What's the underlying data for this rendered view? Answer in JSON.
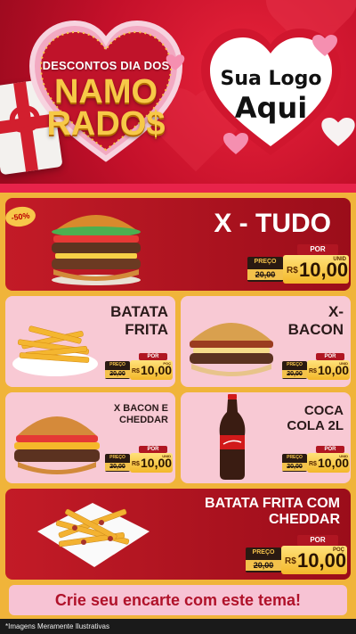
{
  "banner": {
    "line1": "DESCONTOS DIA DOS",
    "line2": "NAMO",
    "line3": "RADO$",
    "logo_line1": "Sua Logo",
    "logo_line2": "Aqui"
  },
  "colors": {
    "red": "#c31b27",
    "gold": "#f7c948",
    "pink": "#f8c9d4",
    "orange": "#f0b43a"
  },
  "discount_badge": "-50%",
  "products": [
    {
      "name": "X - TUDO",
      "por": "POR",
      "preco_label": "PREÇO",
      "old_price": "20,00",
      "currency": "R$",
      "price": "10,00",
      "unit": "UNID",
      "image": "burger-x-tudo"
    },
    {
      "name": "BATATA FRITA",
      "por": "POR",
      "preco_label": "PREÇO",
      "old_price": "20,00",
      "currency": "R$",
      "price": "10,00",
      "unit": "POÇ",
      "image": "french-fries"
    },
    {
      "name": "X-BACON",
      "por": "POR",
      "preco_label": "PREÇO",
      "old_price": "20,00",
      "currency": "R$",
      "price": "10,00",
      "unit": "UNID",
      "image": "burger-x-bacon"
    },
    {
      "name": "X BACON E CHEDDAR",
      "por": "POR",
      "preco_label": "PREÇO",
      "old_price": "20,00",
      "currency": "R$",
      "price": "10,00",
      "unit": "UNID",
      "image": "burger-bacon-cheddar"
    },
    {
      "name": "COCA COLA 2L",
      "por": "POR",
      "preco_label": "PREÇO",
      "old_price": "20,00",
      "currency": "R$",
      "price": "10,00",
      "unit": "UNID",
      "image": "coca-cola-bottle"
    },
    {
      "name": "BATATA FRITA COM CHEDDAR",
      "por": "POR",
      "preco_label": "PREÇO",
      "old_price": "20,00",
      "currency": "R$",
      "price": "10,00",
      "unit": "POÇ",
      "image": "fries-cheddar"
    }
  ],
  "cta": "Crie seu encarte com este tema!",
  "footer": "*Imagens Meramente Ilustrativas"
}
